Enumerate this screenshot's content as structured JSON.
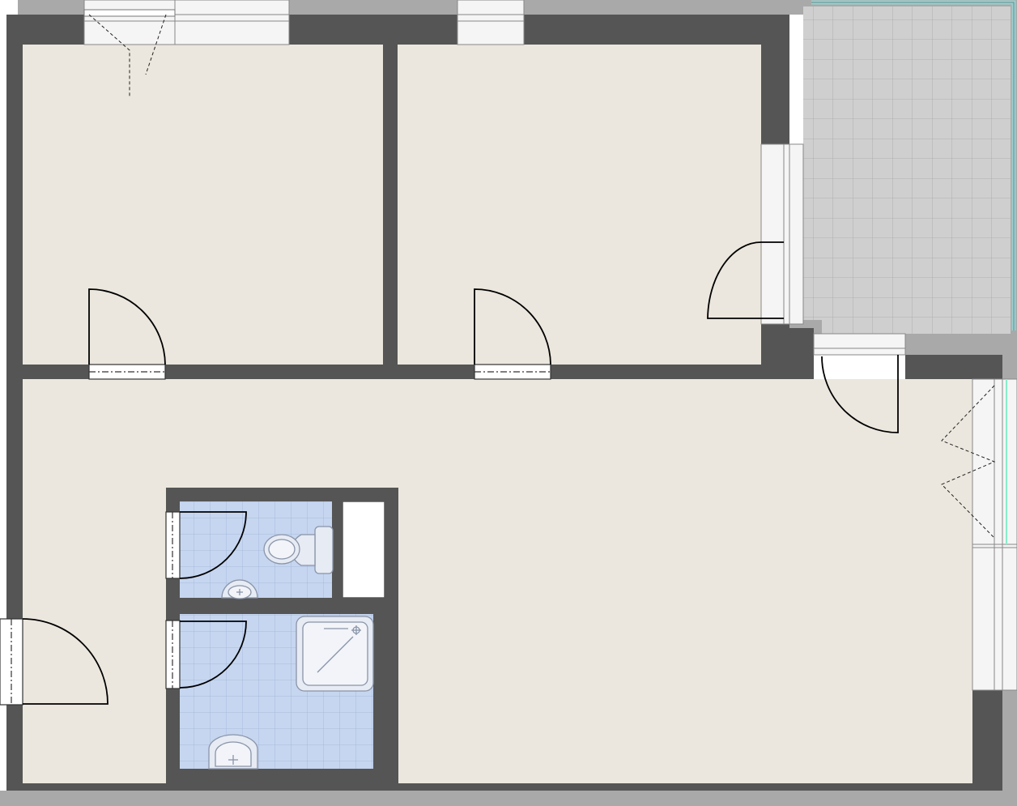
{
  "plan": {
    "colors": {
      "wall": "#555555",
      "floor": "#ebe7de",
      "bathroom_tile": "#c6d6f0",
      "balcony_tile": "#cfcfcf",
      "window_frame": "#f5f5f5",
      "balcony_railing": "#9ccfcf"
    },
    "rooms": [
      {
        "name": "bedroom-left",
        "floor": "wood-beige"
      },
      {
        "name": "bedroom-right",
        "floor": "wood-beige"
      },
      {
        "name": "living-area",
        "floor": "wood-beige"
      },
      {
        "name": "wc",
        "floor": "blue-tile"
      },
      {
        "name": "bathroom",
        "floor": "blue-tile"
      },
      {
        "name": "balcony",
        "floor": "grey-tile"
      }
    ],
    "fixtures": [
      "toilet-icon",
      "hand-sink-icon",
      "shower-tray-icon",
      "washbasin-icon",
      "cabinet"
    ],
    "doors": [
      "bedroom-left-door",
      "bedroom-right-door",
      "balcony-door",
      "terrace-door",
      "entrance-door",
      "wc-door",
      "bathroom-door"
    ],
    "windows": [
      "window-top-left",
      "window-top-middle",
      "window-right-living",
      "window-bedroom-right"
    ]
  }
}
